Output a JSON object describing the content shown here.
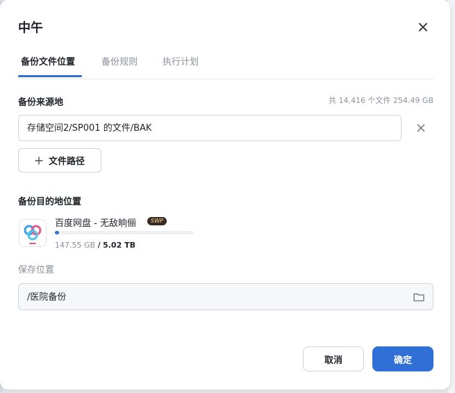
{
  "dialog": {
    "title": "中午",
    "tabs": [
      {
        "label": "备份文件位置",
        "active": true
      },
      {
        "label": "备份规则",
        "active": false
      },
      {
        "label": "执行计划",
        "active": false
      }
    ]
  },
  "source": {
    "heading": "备份来源地",
    "stats": "共 14,416 个文件 254.49 GB",
    "path_value": "存储空间2/SP001 的文件/BAK",
    "add_path_label": "文件路径"
  },
  "destination": {
    "heading": "备份目的地位置",
    "name": "百度网盘 - 无敌晌俪",
    "badge": "SWP",
    "used": "147.55 GB",
    "separator": "/",
    "total": "5.02 TB",
    "usage_fraction": 0.029
  },
  "save": {
    "label": "保存位置",
    "path_value": "/医院备份"
  },
  "footer": {
    "cancel_label": "取消",
    "ok_label": "确定"
  },
  "colors": {
    "accent": "#2f6fd6",
    "badge_bg": "#3a2a24"
  },
  "icons": {
    "close": "close-icon",
    "clear": "clear-icon",
    "plus": "plus-icon",
    "baidu": "baidu-netdisk-logo-icon",
    "folder": "folder-icon"
  }
}
